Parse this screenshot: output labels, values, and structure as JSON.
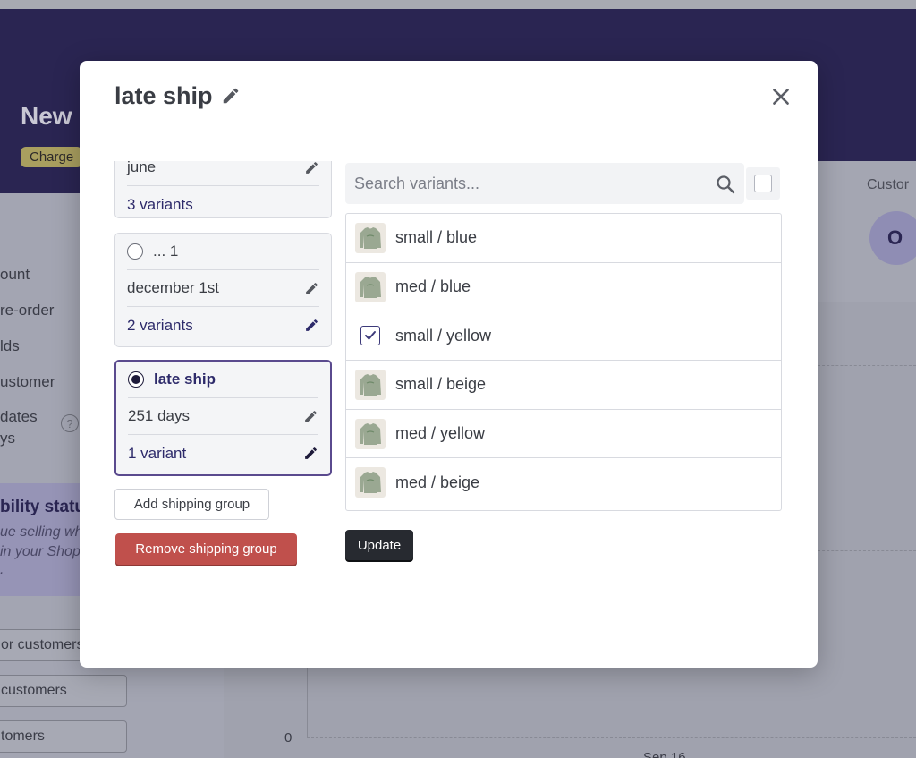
{
  "background": {
    "title": "New",
    "badge": "Charge",
    "customers_label": "Custor",
    "avatar_letter": "O",
    "nav_items": [
      "ount",
      "re-order",
      "lds",
      "ustomer",
      "dates",
      "ys"
    ],
    "visibility_title": "bility statu",
    "visibility_lines": [
      "ue selling wh",
      "in your Shop",
      "."
    ],
    "buttons": [
      "or customers",
      "customers",
      "tomers"
    ],
    "chart_zero": "0",
    "chart_date": "Sep 16",
    "help_icon": "?"
  },
  "modal": {
    "title": "late ship",
    "title_icon": "pencil-icon",
    "close_icon": "close-icon",
    "groups": [
      {
        "name": "",
        "shipping": "june",
        "variants": "3 variants",
        "selected": false
      },
      {
        "name": "... 1",
        "shipping": "december 1st",
        "variants": "2 variants",
        "selected": false
      },
      {
        "name": "late ship",
        "shipping": "251 days",
        "variants": "1 variant",
        "selected": true
      }
    ],
    "add_group_label": "Add shipping group",
    "remove_group_label": "Remove shipping group",
    "search": {
      "placeholder": "Search variants...",
      "value": ""
    },
    "variants": [
      {
        "label": "small / blue",
        "checked": false
      },
      {
        "label": "med / blue",
        "checked": false
      },
      {
        "label": "small / yellow",
        "checked": true
      },
      {
        "label": "small / beige",
        "checked": false
      },
      {
        "label": "med / yellow",
        "checked": false
      },
      {
        "label": "med / beige",
        "checked": false
      }
    ],
    "update_label": "Update"
  },
  "colors": {
    "accent": "#2d2a6a",
    "header_bg": "#2a2552",
    "danger": "#c0504c",
    "dark_button": "#272a30"
  }
}
